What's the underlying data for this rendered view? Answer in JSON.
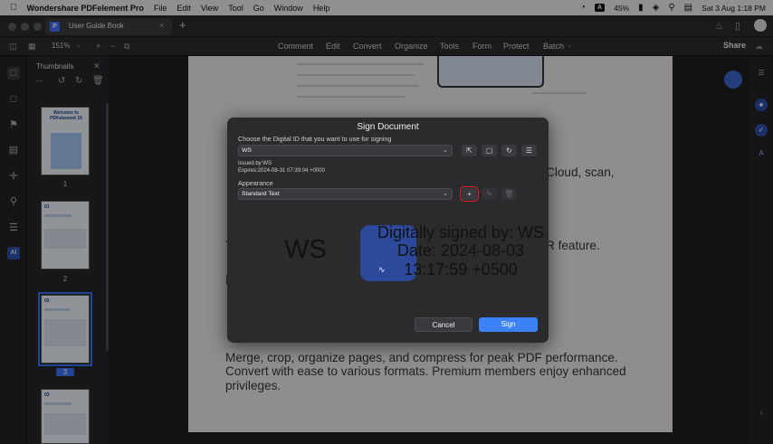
{
  "menubar": {
    "app_name": "Wondershare PDFelement Pro",
    "items": [
      "File",
      "Edit",
      "View",
      "Tool",
      "Go",
      "Window",
      "Help"
    ],
    "battery": "45%",
    "datetime": "Sat 3 Aug  1:18 PM"
  },
  "tabbar": {
    "doc_title": "User Guide Book",
    "add_tab": "+"
  },
  "toolbar": {
    "zoom": "151%",
    "tabs": [
      "Comment",
      "Edit",
      "Convert",
      "Organize",
      "Tools",
      "Form",
      "Protect",
      "Batch"
    ],
    "share_label": "Share"
  },
  "thumbnails": {
    "title": "Thumbnails",
    "more": "...",
    "pages": [
      {
        "number": "1",
        "heading": "Welcome to PDFelement 10",
        "selected": false
      },
      {
        "number": "2",
        "heading": "01",
        "selected": false
      },
      {
        "number": "3",
        "heading": "02",
        "selected": true
      },
      {
        "number": "",
        "heading": "03",
        "selected": false
      }
    ]
  },
  "document": {
    "partial_right_1": "Cloud, scan,",
    "partial_left_1": "T",
    "partial_right_2": "R feature.",
    "partial_left_2": "P",
    "paragraph": [
      "Merge, crop, organize pages, and compress for peak PDF performance.",
      "Convert with ease to various formats. Premium members enjoy enhanced",
      "privileges."
    ]
  },
  "dialog": {
    "title": "Sign Document",
    "digital_id_prompt": "Choose the Digital ID that you want to use for signing",
    "digital_id_value": "WS",
    "issued_by": "Issued by:WS",
    "expires": "Expires:2024-08-31 07:39:04 +0000",
    "appearance_label": "Appearance",
    "appearance_value": "Standard Text",
    "preview": {
      "name": "WS",
      "line1": "Digitally signed by: WS",
      "line2": "Date: 2024-08-03",
      "line3": "13:17:59 +0500"
    },
    "cancel_label": "Cancel",
    "sign_label": "Sign"
  },
  "colors": {
    "accent": "#3b82f6",
    "highlight": "#e0202a",
    "brand": "#2e4ca6"
  }
}
